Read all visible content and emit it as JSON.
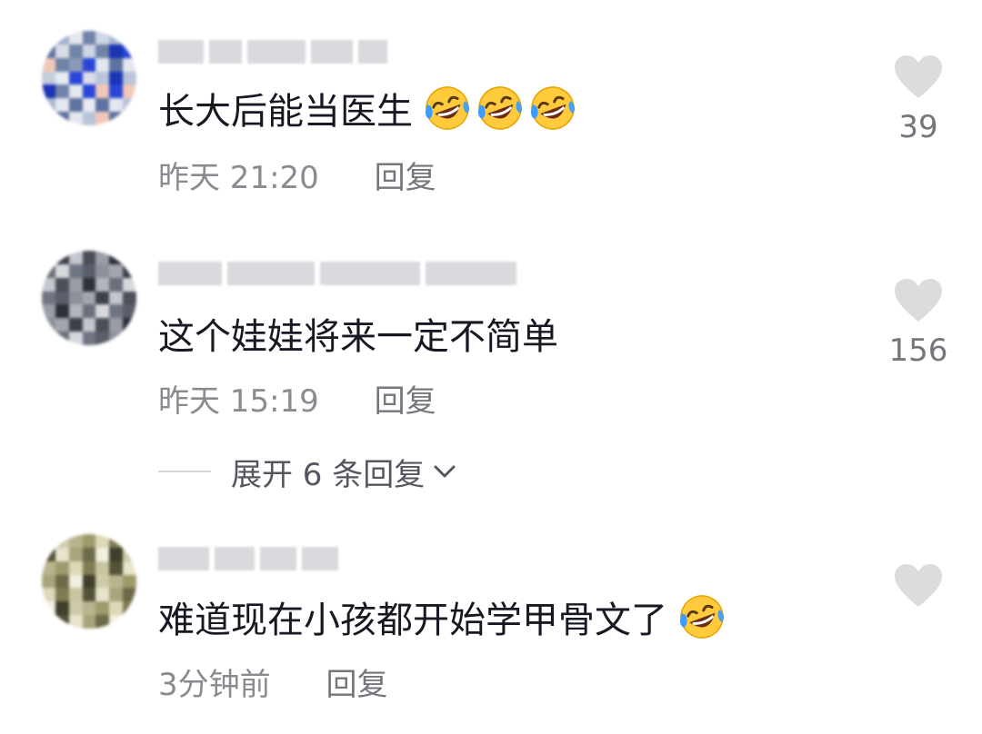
{
  "comments": [
    {
      "text": "长大后能当医生",
      "emoji_count": 3,
      "time": "昨天 21:20",
      "reply_label": "回复",
      "likes": "39",
      "avatar_icon": "blurred-avatar-icon"
    },
    {
      "text": "这个娃娃将来一定不简单",
      "emoji_count": 0,
      "time": "昨天 15:19",
      "reply_label": "回复",
      "likes": "156",
      "avatar_icon": "blurred-avatar-icon",
      "expand_label": "展开 6 条回复"
    },
    {
      "text": "难道现在小孩都开始学甲骨文了",
      "emoji_count": 1,
      "time": "3分钟前",
      "reply_label": "回复",
      "likes": "",
      "avatar_icon": "blurred-avatar-icon"
    }
  ],
  "icons": {
    "like": "heart-icon",
    "emoji": "rolling-on-floor-laughing-emoji",
    "expand": "chevron-down-icon"
  },
  "colors": {
    "text": "#161823",
    "meta": "#8a8b91",
    "heart": "#dcdcdf",
    "emoji_face": "#ffcb3d"
  }
}
